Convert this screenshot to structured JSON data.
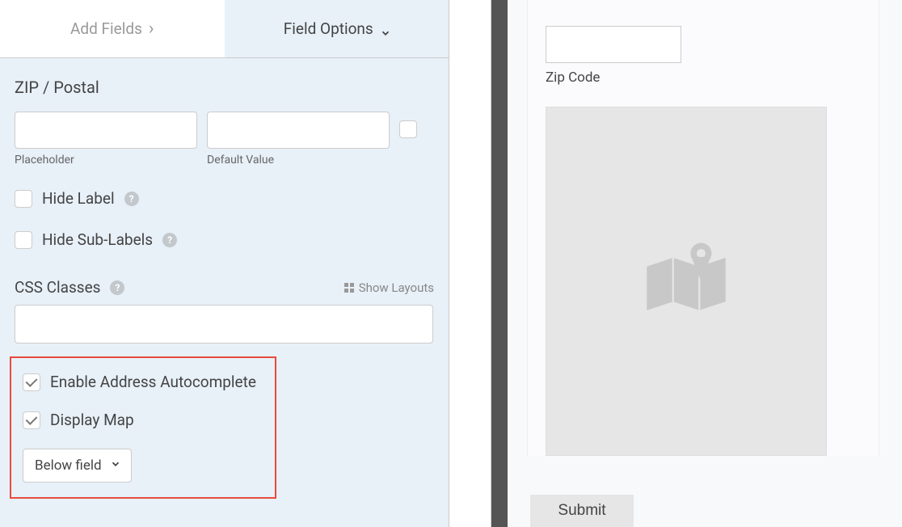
{
  "tabs": {
    "add_fields": "Add Fields",
    "field_options": "Field Options"
  },
  "zip_postal": {
    "section_title": "ZIP / Postal",
    "placeholder_label": "Placeholder",
    "default_value_label": "Default Value"
  },
  "options": {
    "hide_label": "Hide Label",
    "hide_sub_labels": "Hide Sub-Labels"
  },
  "css": {
    "label": "CSS Classes",
    "show_layouts": "Show Layouts"
  },
  "autocomplete": {
    "enable": "Enable Address Autocomplete",
    "display_map": "Display Map",
    "position": "Below field"
  },
  "preview": {
    "zip_label": "Zip Code",
    "submit": "Submit"
  }
}
